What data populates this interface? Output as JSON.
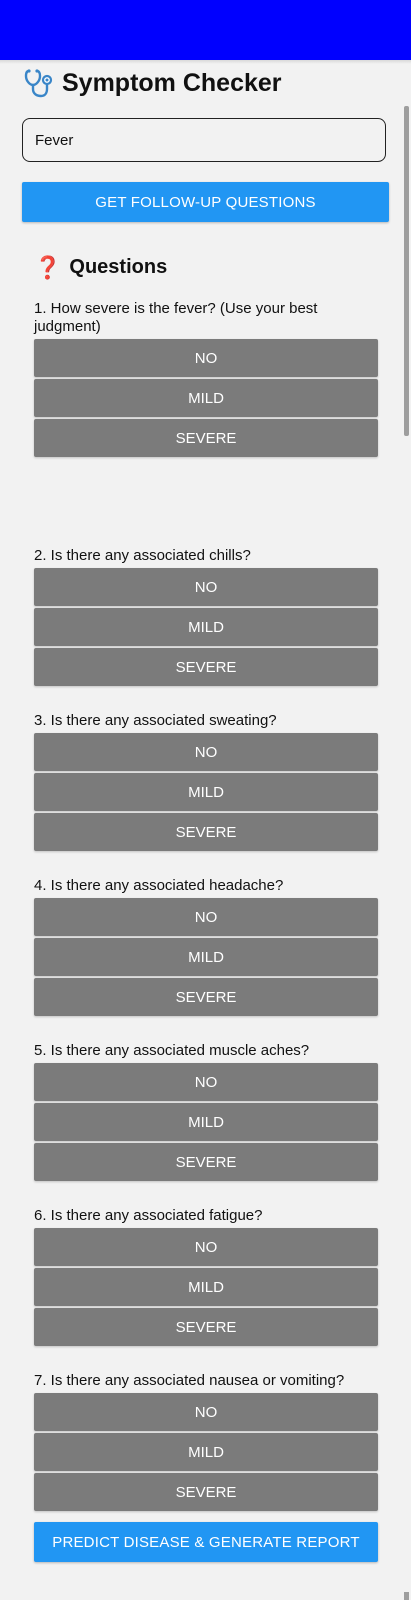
{
  "app": {
    "title": "Symptom Checker",
    "header_color": "#0000ff"
  },
  "symptom_input": {
    "value": "Fever"
  },
  "get_button": {
    "label": "GET FOLLOW-UP QUESTIONS"
  },
  "questions_section": {
    "title": "Questions",
    "icon": "question-mark-icon"
  },
  "options": [
    "NO",
    "MILD",
    "SEVERE"
  ],
  "questions": [
    {
      "text": "1. How severe is the fever?  (Use your best judgment)"
    },
    {
      "text": "2. Is there any associated chills?"
    },
    {
      "text": "3. Is there any associated sweating?"
    },
    {
      "text": "4. Is there any associated headache?"
    },
    {
      "text": "5. Is there any associated muscle aches?"
    },
    {
      "text": "6. Is there any associated fatigue?"
    },
    {
      "text": "7. Is there any associated nausea or vomiting?"
    }
  ],
  "predict_button": {
    "label": "PREDICT DISEASE & GENERATE REPORT"
  },
  "colors": {
    "primary": "#2196f3",
    "option": "#7b7b7b"
  }
}
